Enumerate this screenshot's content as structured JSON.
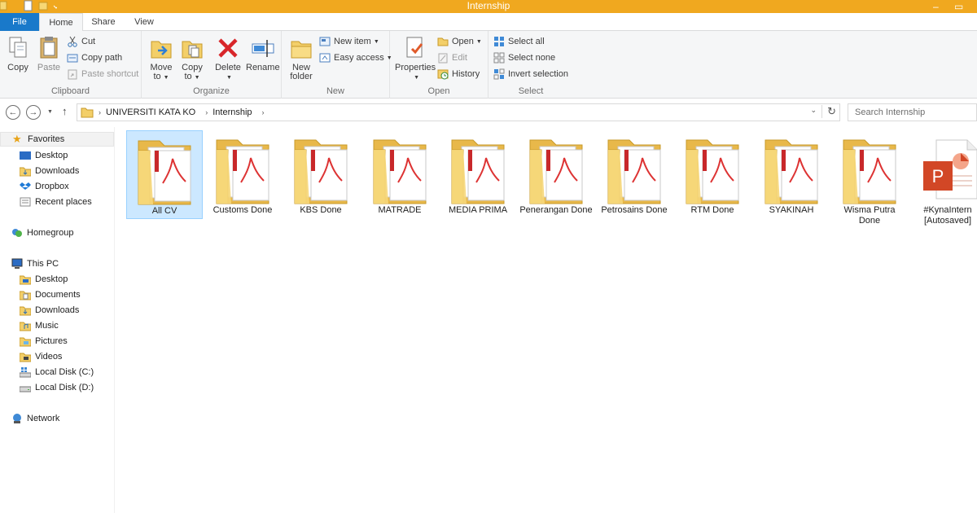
{
  "window": {
    "title": "Internship"
  },
  "tabs": {
    "file": "File",
    "home": "Home",
    "share": "Share",
    "view": "View"
  },
  "ribbon": {
    "clipboard": {
      "label": "Clipboard",
      "copy": "Copy",
      "paste": "Paste",
      "cut": "Cut",
      "copy_path": "Copy path",
      "paste_shortcut": "Paste shortcut"
    },
    "organize": {
      "label": "Organize",
      "move_to": [
        "Move",
        "to"
      ],
      "copy_to": [
        "Copy",
        "to"
      ],
      "delete": "Delete",
      "rename": "Rename"
    },
    "new": {
      "label": "New",
      "new_folder": [
        "New",
        "folder"
      ],
      "new_item": "New item",
      "easy_access": "Easy access"
    },
    "open": {
      "label": "Open",
      "properties": "Properties",
      "open": "Open",
      "edit": "Edit",
      "history": "History"
    },
    "select": {
      "label": "Select",
      "select_all": "Select all",
      "select_none": "Select none",
      "invert_selection": "Invert selection"
    }
  },
  "address": {
    "crumbs": [
      "UNIVERSITI KATA KO",
      "Internship"
    ],
    "search_placeholder": "Search Internship"
  },
  "nav": {
    "favorites": "Favorites",
    "fav_items": [
      "Desktop",
      "Downloads",
      "Dropbox",
      "Recent places"
    ],
    "homegroup": "Homegroup",
    "this_pc": "This PC",
    "pc_items": [
      "Desktop",
      "Documents",
      "Downloads",
      "Music",
      "Pictures",
      "Videos",
      "Local Disk (C:)",
      "Local Disk (D:)"
    ],
    "network": "Network"
  },
  "files": [
    {
      "name": "All CV",
      "type": "folder",
      "selected": true
    },
    {
      "name": "Customs Done",
      "type": "folder"
    },
    {
      "name": "KBS Done",
      "type": "folder"
    },
    {
      "name": "MATRADE",
      "type": "folder"
    },
    {
      "name": "MEDIA PRIMA",
      "type": "folder"
    },
    {
      "name": "Penerangan Done",
      "type": "folder"
    },
    {
      "name": "Petrosains Done",
      "type": "folder"
    },
    {
      "name": "RTM Done",
      "type": "folder"
    },
    {
      "name": "SYAKINAH",
      "type": "folder"
    },
    {
      "name": "Wisma Putra Done",
      "type": "folder"
    },
    {
      "name": "#KynaIntern [Autosaved]",
      "type": "pptx"
    }
  ],
  "colors": {
    "titlebar": "#f0a81f",
    "file_tab": "#1979ca",
    "selection": "#cce8ff",
    "folder": "#f3cf69"
  }
}
